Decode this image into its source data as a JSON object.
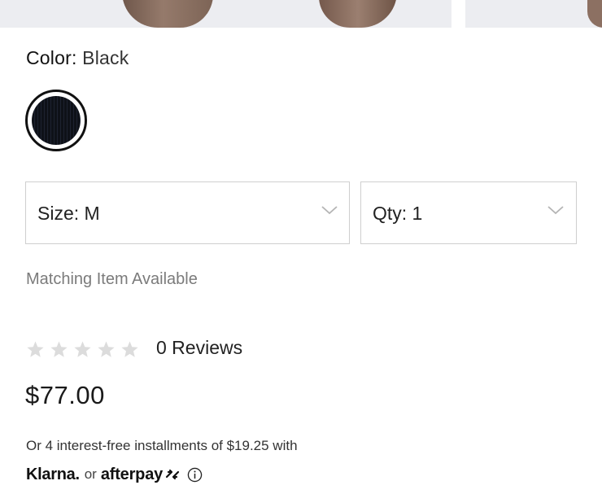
{
  "product": {
    "color_label": "Color:",
    "color_value": "Black",
    "swatch_color": "#0e1118"
  },
  "selectors": {
    "size_text": "Size: M",
    "qty_text": "Qty: 1"
  },
  "matching_text": "Matching Item Available",
  "reviews": {
    "rating": 0,
    "max_stars": 5,
    "count_text": "0 Reviews"
  },
  "price": "$77.00",
  "payment": {
    "installments_text": "Or 4 interest-free installments of $19.25 with",
    "klarna_label": "Klarna.",
    "or_label": "or",
    "afterpay_label": "afterpay"
  },
  "icons": {
    "dropdown": "chevron-down-icon",
    "star": "star-icon",
    "info": "info-icon",
    "afterpay": "afterpay-arrows-icon"
  }
}
